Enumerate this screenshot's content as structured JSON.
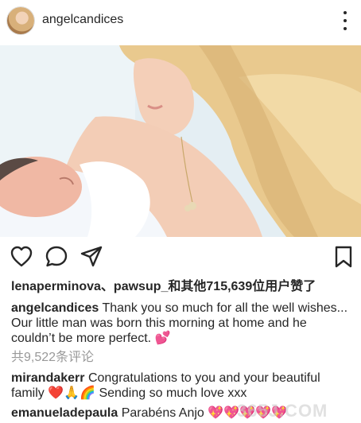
{
  "header": {
    "username": "angelcandices",
    "more_icon": "more-vertical-icon"
  },
  "photo": {
    "description_icon": "post-image"
  },
  "actions": {
    "like_icon": "heart-outline-icon",
    "comment_icon": "comment-icon",
    "share_icon": "paper-plane-icon",
    "save_icon": "bookmark-icon"
  },
  "likes": {
    "text": "lenaperminova、pawsup_和其他715,639位用户赞了"
  },
  "caption": {
    "username": "angelcandices",
    "line1": " Thank you so much for all the well wishes...",
    "line2": "Our little man was born this morning at home and he",
    "line3": "couldn’t be more perfect. 💕"
  },
  "comments_count": "共9,522条评论",
  "comments": [
    {
      "username": "mirandakerr",
      "line1": " Congratulations to you and your beautiful",
      "line2": "family ❤️🙏🌈 Sending so much love xxx"
    },
    {
      "username": "emanueladepaula",
      "line1": " Parabéns Anjo 💖💖💖💖💖"
    }
  ],
  "watermark": "365J.COM"
}
